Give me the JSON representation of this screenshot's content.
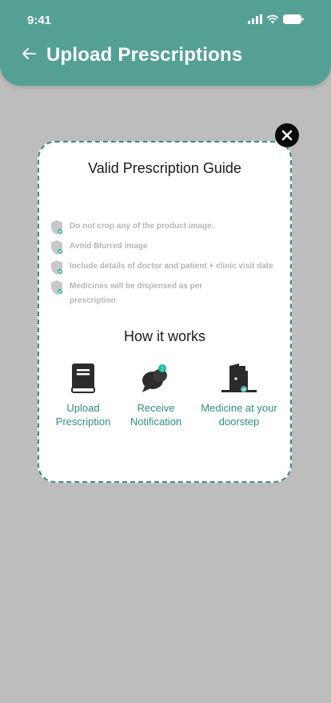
{
  "status_bar": {
    "time": "9:41"
  },
  "header": {
    "title": "Upload Prescriptions"
  },
  "modal": {
    "guide_title": "Valid Prescription Guide",
    "rules": [
      "Do not crop any of the product image.",
      "Avoid Blurred image",
      "Include details of doctor and patient + clinic visit date",
      "Medicines will be dispensed as per prescription"
    ],
    "how_title": "How it works",
    "steps": [
      {
        "label": "Upload Prescription",
        "icon": "book-icon"
      },
      {
        "label": "Receive Notification",
        "icon": "chat-notification-icon",
        "badge": "2"
      },
      {
        "label": "Medicine at your doorstep",
        "icon": "door-icon"
      }
    ]
  },
  "colors": {
    "accent": "#55a095",
    "step_text": "#2f8f86",
    "overlay": "#bdbdbd"
  }
}
